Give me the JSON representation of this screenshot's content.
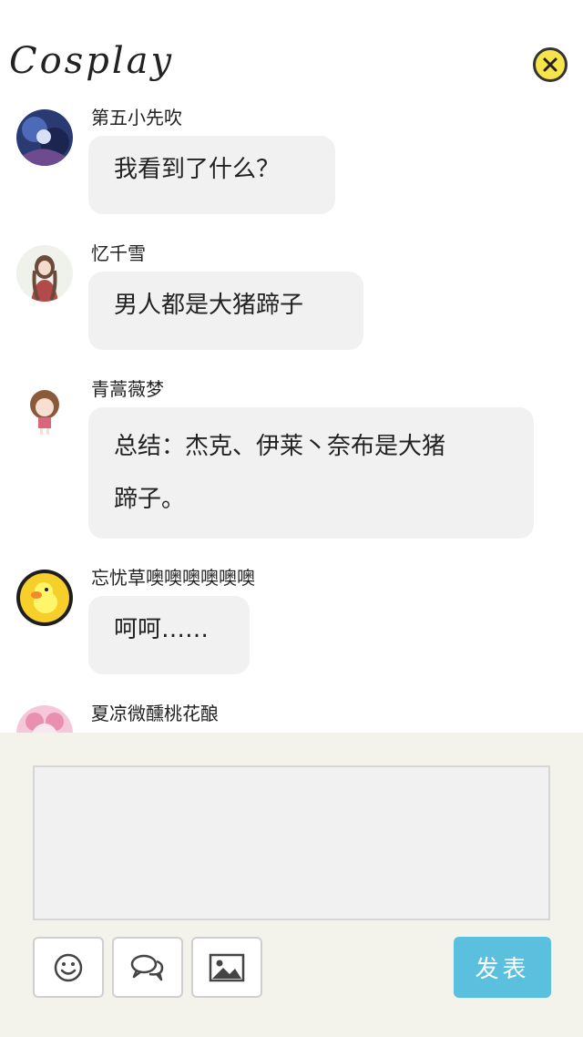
{
  "header": {
    "title": "Cosplay",
    "close_icon": "close-icon",
    "close_color": "#f7e34a"
  },
  "messages": [
    {
      "name": "第五小先吹",
      "text": "我看到了什么？"
    },
    {
      "name": "忆千雪",
      "text": "男人都是大猪蹄子"
    },
    {
      "name": "青蒿薇梦",
      "text": "总结：杰克、伊莱丶奈布是大猪",
      "text2": "蹄子。"
    },
    {
      "name": "忘忧草噢噢噢噢噢噢",
      "text": "呵呵……"
    },
    {
      "name": "夏凉微醺桃花酿",
      "text": ""
    }
  ],
  "composer": {
    "input_value": "",
    "tools": [
      "smiley-icon",
      "chat-bubbles-icon",
      "image-icon"
    ],
    "send_label": "发表",
    "send_color": "#5bc0de"
  }
}
